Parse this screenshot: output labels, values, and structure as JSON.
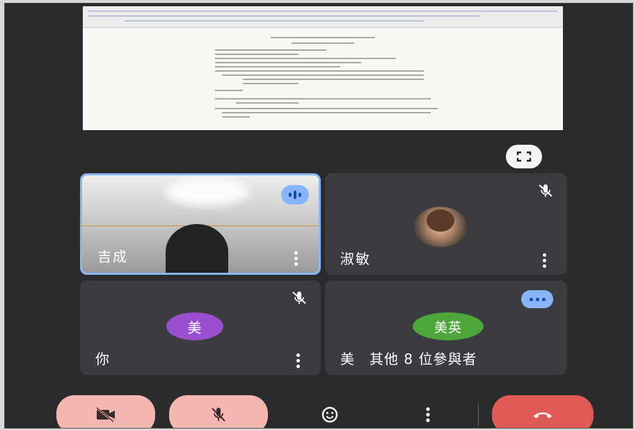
{
  "participants": [
    {
      "name": "吉成",
      "state": "speaking"
    },
    {
      "name": "淑敏",
      "state": "muted",
      "has_photo": true
    },
    {
      "name": "你",
      "avatar_text": "美",
      "avatar_color": "#9b4fd0",
      "state": "muted"
    },
    {
      "name": "美　其他 8 位參與者",
      "avatar_text": "美英",
      "avatar_color": "#4ea63a",
      "state": "others"
    }
  ],
  "colors": {
    "background": "#2b2b2d",
    "tile": "#3a3c40",
    "active_border": "#8ab4f8",
    "off_button": "#f3b6b0",
    "end_call": "#e05a56"
  },
  "controls": [
    {
      "icon": "camera-off-icon",
      "state": "off"
    },
    {
      "icon": "mic-off-icon",
      "state": "off"
    },
    {
      "icon": "emoji-icon"
    },
    {
      "icon": "more-vert-icon"
    },
    {
      "icon": "hang-up-icon"
    }
  ],
  "toolbar": {
    "fullscreen_icon": "fullscreen-icon"
  }
}
